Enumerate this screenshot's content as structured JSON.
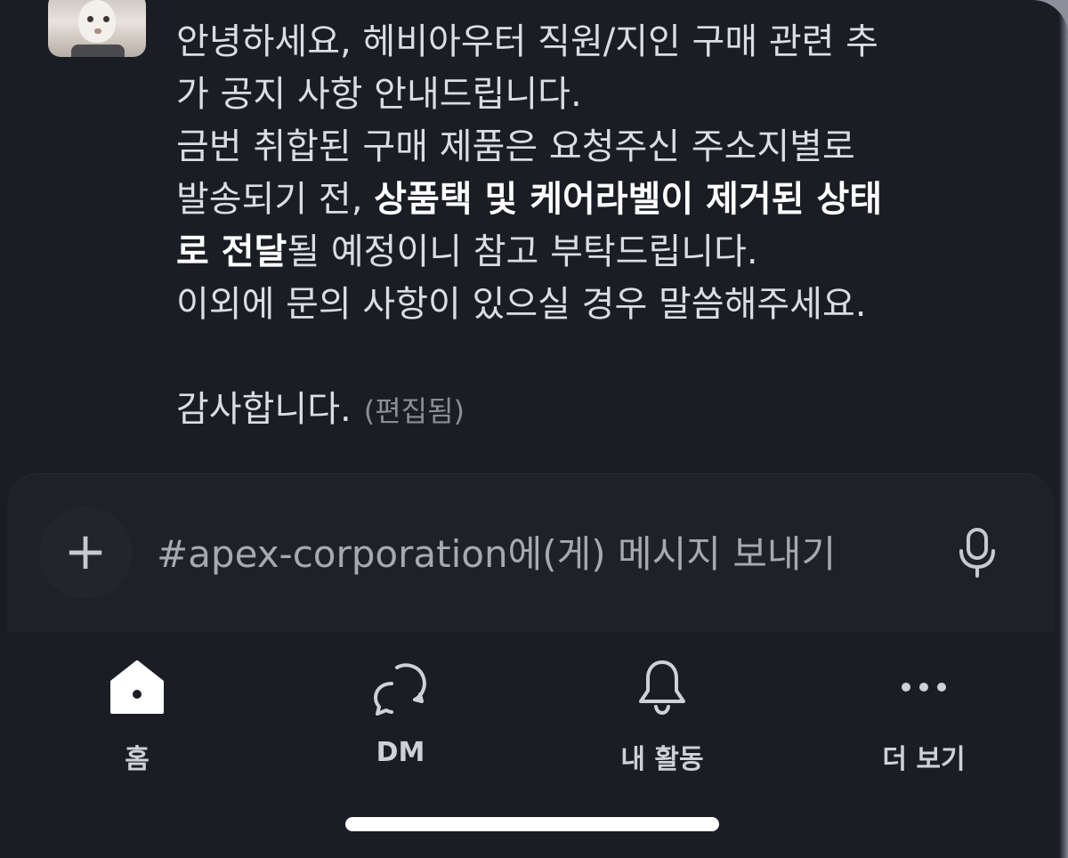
{
  "message": {
    "lines": [
      [
        {
          "text": "안녕하세요, 헤비아우터 직원/지인 구매 관련 추"
        }
      ],
      [
        {
          "text": "가 공지 사항 안내드립니다."
        }
      ],
      [
        {
          "text": "금번 취합된 구매 제품은 요청주신 주소지별로"
        }
      ],
      [
        {
          "text": "발송되기 전, "
        },
        {
          "text": "상품택 및 케어라벨이 제거된 상태",
          "bold": true
        }
      ],
      [
        {
          "text": "로 전달",
          "bold": true
        },
        {
          "text": "될 예정이니 참고 부탁드립니다."
        }
      ],
      [
        {
          "text": "이외에 문의 사항이 있으실 경우 말씀해주세요."
        }
      ]
    ],
    "closing": "감사합니다.",
    "edited_label": "(편집됨)"
  },
  "composer": {
    "placeholder": "#apex-corporation에(게) 메시지 보내기",
    "add_label": "+"
  },
  "nav": {
    "home": "홈",
    "dm": "DM",
    "activity": "내 활동",
    "more": "더 보기"
  },
  "icons": {
    "avatar": "avatar",
    "add": "plus-icon",
    "mic": "microphone-icon",
    "home": "home-icon",
    "dm": "dm-icon",
    "activity": "bell-icon",
    "more": "more-icon"
  },
  "colors": {
    "background": "#1b1d24",
    "text": "#dcdde1",
    "muted": "#8c8e96"
  }
}
